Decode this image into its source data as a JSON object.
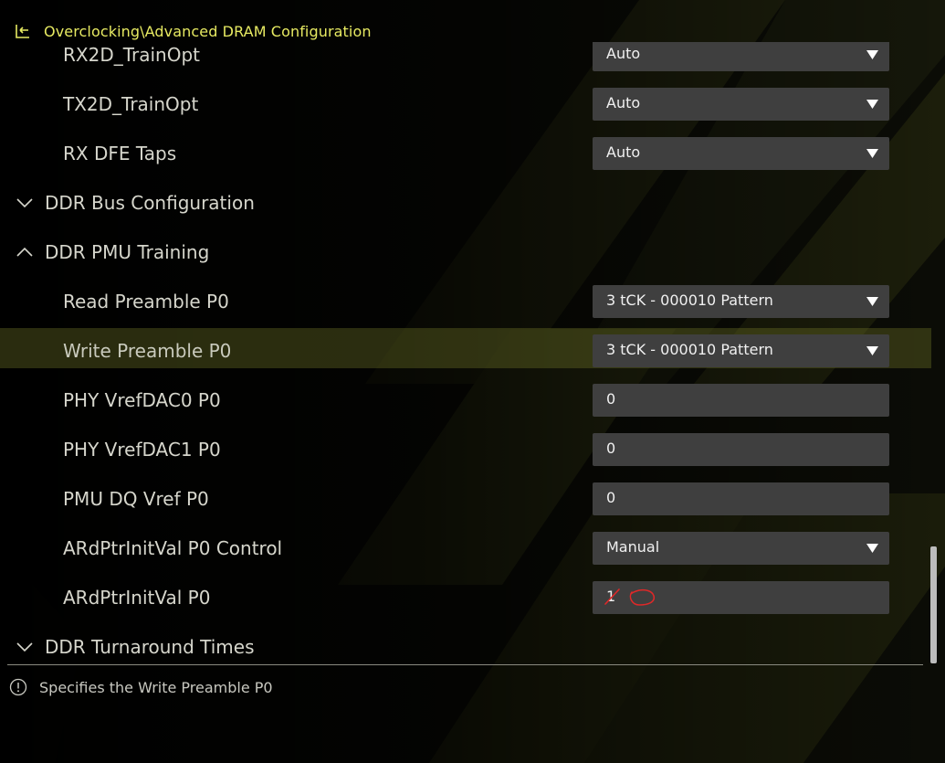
{
  "header": {
    "breadcrumb": "Overclocking\\Advanced DRAM Configuration",
    "back_icon": "back-arrow-icon",
    "accent_color": "#e7ea62"
  },
  "rows": [
    {
      "label": "RX2D_TrainOpt",
      "value": "Auto",
      "kind": "dropdown"
    },
    {
      "label": "TX2D_TrainOpt",
      "value": "Auto",
      "kind": "dropdown"
    },
    {
      "label": "RX DFE Taps",
      "value": "Auto",
      "kind": "dropdown"
    },
    {
      "label": "DDR Bus Configuration",
      "kind": "section",
      "state": "collapsed"
    },
    {
      "label": "DDR PMU Training",
      "kind": "section",
      "state": "expanded"
    },
    {
      "label": "Read Preamble P0",
      "value": "3 tCK - 000010 Pattern",
      "kind": "dropdown"
    },
    {
      "label": "Write Preamble P0",
      "value": "3 tCK - 000010 Pattern",
      "kind": "dropdown",
      "selected": true
    },
    {
      "label": "PHY VrefDAC0 P0",
      "value": "0",
      "kind": "field"
    },
    {
      "label": "PHY VrefDAC1 P0",
      "value": "0",
      "kind": "field"
    },
    {
      "label": "PMU DQ Vref P0",
      "value": "0",
      "kind": "field"
    },
    {
      "label": "ARdPtrInitVal P0 Control",
      "value": "Manual",
      "kind": "dropdown"
    },
    {
      "label": "ARdPtrInitVal P0",
      "value": "1",
      "kind": "field"
    },
    {
      "label": "DDR Turnaround Times",
      "kind": "section",
      "state": "collapsed"
    }
  ],
  "help": {
    "text": "Specifies the Write Preamble P0",
    "icon": "info-icon"
  },
  "colors": {
    "control_bg": "#3f3f3f",
    "highlight_row": "#3a3c16",
    "annotation": "#e02828"
  }
}
